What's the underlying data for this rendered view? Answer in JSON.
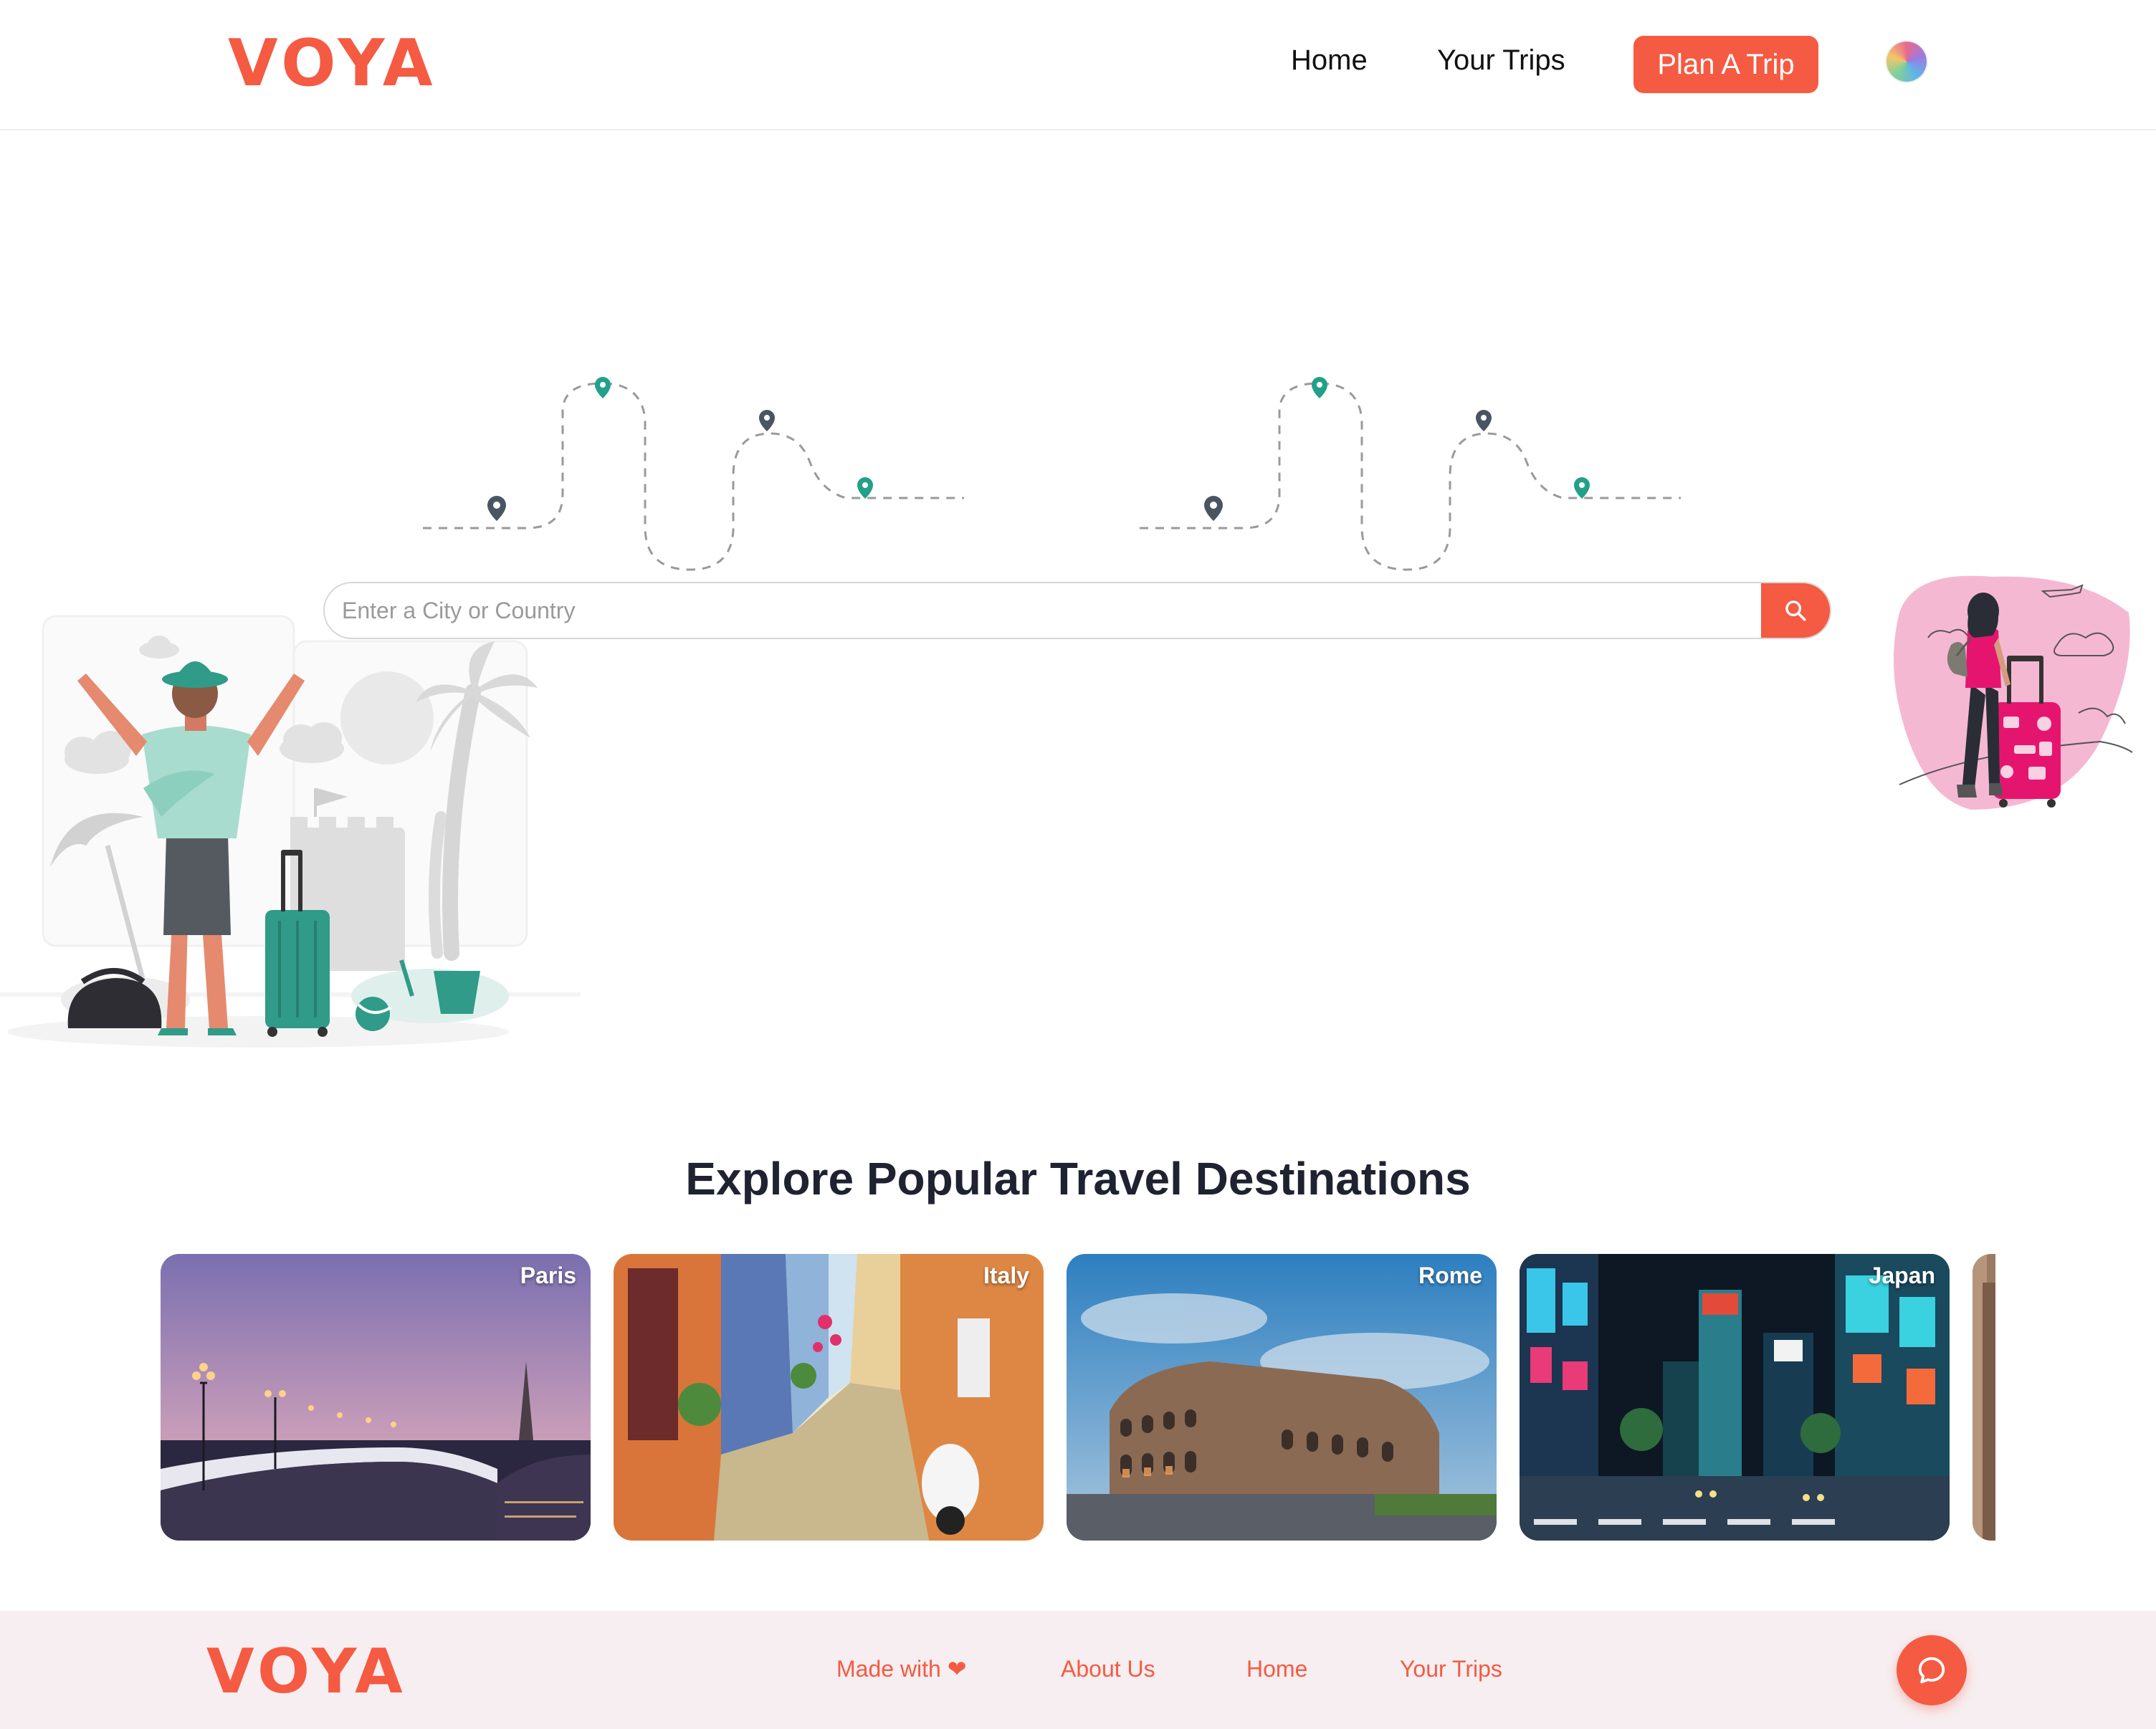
{
  "brand": {
    "logo_text": "VOYA",
    "accent_color": "#f55a42",
    "text_color": "#1f2230"
  },
  "header": {
    "nav": {
      "home": "Home",
      "your_trips": "Your Trips"
    },
    "plan_button": "Plan A Trip",
    "avatar_icon": "user-avatar"
  },
  "hero": {
    "search": {
      "placeholder": "Enter a City or Country",
      "value": "",
      "button_icon": "search-icon"
    },
    "route_pin_colors": [
      "#4a5562",
      "#23a08a"
    ]
  },
  "destinations": {
    "title": "Explore Popular Travel Destinations",
    "cards": [
      {
        "name": "Paris"
      },
      {
        "name": "Italy"
      },
      {
        "name": "Rome"
      },
      {
        "name": "Japan"
      }
    ]
  },
  "footer": {
    "logo_text": "VOYA",
    "made_with": "Made with ❤",
    "about": "About Us",
    "home": "Home",
    "your_trips": "Your Trips",
    "chat_icon": "chat-bubble-icon",
    "background_color": "#f6eef0"
  }
}
